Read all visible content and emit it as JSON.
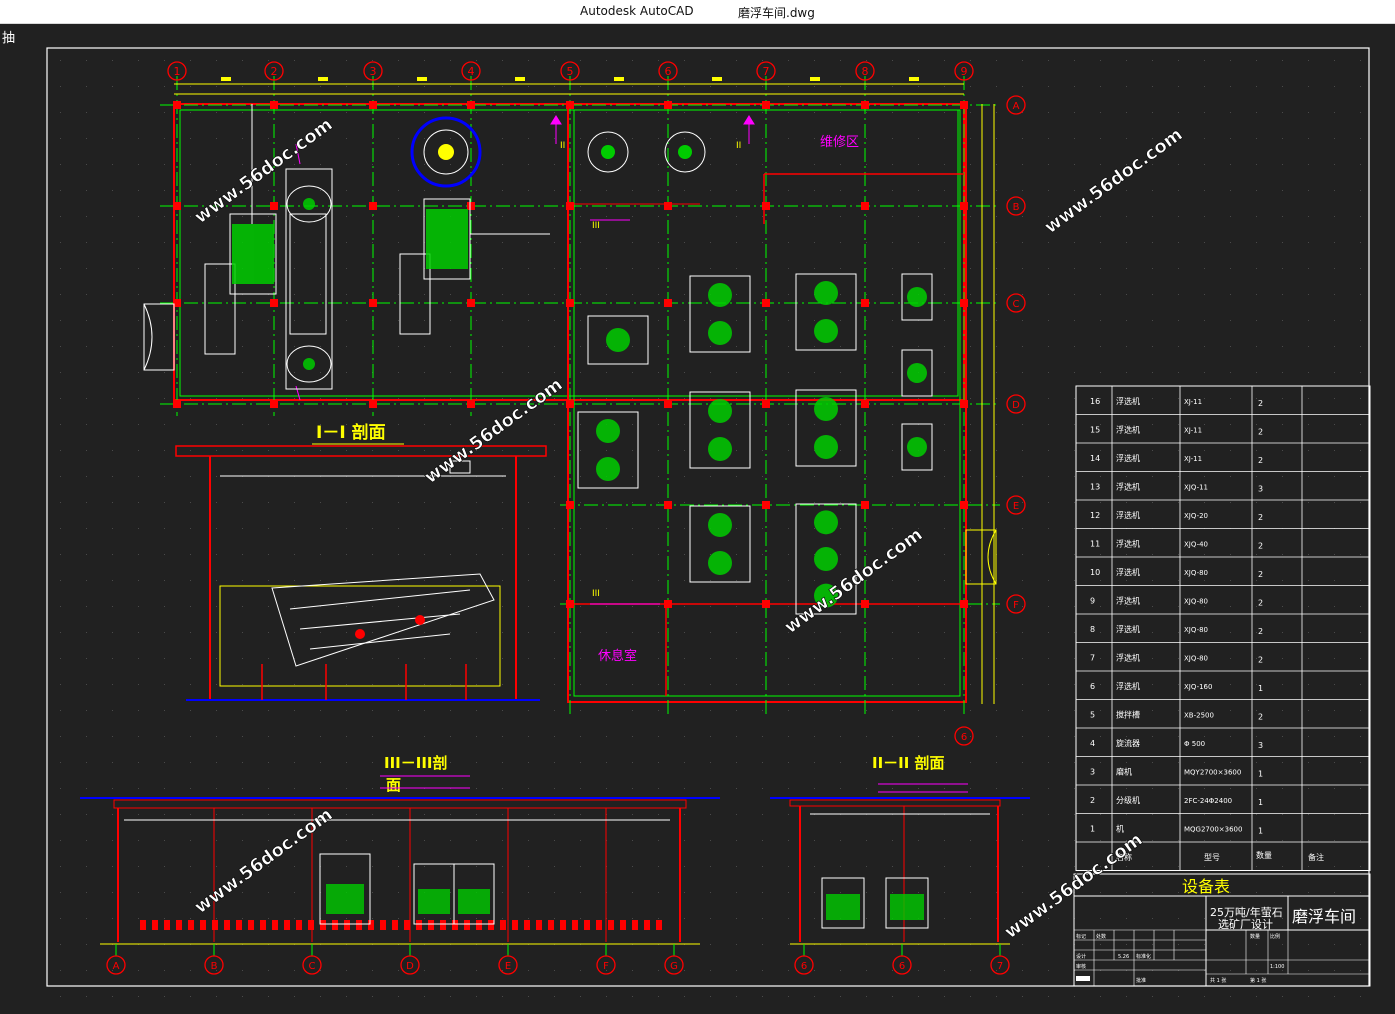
{
  "window": {
    "app_name": "Autodesk AutoCAD",
    "file_name": "磨浮车间.dwg",
    "corner_glyph": "抽"
  },
  "colors": {
    "background": "#212121",
    "frame": "#ffffff",
    "grid_axis": "#00ff00",
    "wall": "#ff0000",
    "dimension": "#ffff00",
    "annotation": "#ff00ff",
    "equipment": "#ffffff",
    "equipment_fill": "#00cc00",
    "accent_blue": "#0000ff",
    "watermark": "#ffffff"
  },
  "drawing": {
    "grid_columns": [
      "1",
      "2",
      "3",
      "4",
      "5",
      "6",
      "7",
      "8",
      "9"
    ],
    "grid_rows": [
      "A",
      "B",
      "C",
      "D",
      "E",
      "F"
    ],
    "room_labels": {
      "maintenance": "维修区",
      "rest_room": "休息室"
    },
    "section_titles": {
      "s1": "I－I 剖面",
      "s2": "II－II 剖面",
      "s3_line1": "III－III剖",
      "s3_line2": "面"
    },
    "section3_axes": [
      "A",
      "B",
      "C",
      "D",
      "E",
      "F",
      "G"
    ],
    "section2_axes": [
      "6",
      "6",
      "7"
    ],
    "watermark_text": "www.56doc.com"
  },
  "equipment_table": {
    "rows": [
      {
        "no": "16",
        "name": "浮选机",
        "model": "XJ-11",
        "qty": "2",
        "note": ""
      },
      {
        "no": "15",
        "name": "浮选机",
        "model": "XJ-11",
        "qty": "2",
        "note": ""
      },
      {
        "no": "14",
        "name": "浮选机",
        "model": "XJ-11",
        "qty": "2",
        "note": ""
      },
      {
        "no": "13",
        "name": "浮选机",
        "model": "XJQ-11",
        "qty": "3",
        "note": ""
      },
      {
        "no": "12",
        "name": "浮选机",
        "model": "XJQ-20",
        "qty": "2",
        "note": ""
      },
      {
        "no": "11",
        "name": "浮选机",
        "model": "XJQ-40",
        "qty": "2",
        "note": ""
      },
      {
        "no": "10",
        "name": "浮选机",
        "model": "XJQ-80",
        "qty": "2",
        "note": ""
      },
      {
        "no": "9",
        "name": "浮选机",
        "model": "XJQ-80",
        "qty": "2",
        "note": ""
      },
      {
        "no": "8",
        "name": "浮选机",
        "model": "XJQ-80",
        "qty": "2",
        "note": ""
      },
      {
        "no": "7",
        "name": "浮选机",
        "model": "XJQ-80",
        "qty": "2",
        "note": ""
      },
      {
        "no": "6",
        "name": "浮选机",
        "model": "XJQ-160",
        "qty": "1",
        "note": ""
      },
      {
        "no": "5",
        "name": "搅拌槽",
        "model": "XB-2500",
        "qty": "2",
        "note": ""
      },
      {
        "no": "4",
        "name": "旋流器",
        "model": "Φ 500",
        "qty": "3",
        "note": ""
      },
      {
        "no": "3",
        "name": "磨机",
        "model": "MQY2700×3600",
        "qty": "1",
        "note": ""
      },
      {
        "no": "2",
        "name": "分级机",
        "model": "2FC-24Φ2400",
        "qty": "1",
        "note": ""
      },
      {
        "no": "1",
        "name": "机",
        "model": "MQG2700×3600",
        "qty": "1",
        "note": ""
      }
    ],
    "header": {
      "name": "名称",
      "model": "型号",
      "qty": "数量",
      "note": "备注"
    },
    "title": "设备表"
  },
  "title_block": {
    "project_line1": "25万吨/年萤石",
    "project_line2": "选矿厂设计",
    "drawing_name": "磨浮车间",
    "label_biaoji": "标记",
    "label_chushu": "处数",
    "label_sheji": "设计",
    "label_date": "5.26",
    "label_biaozhun": "标准化",
    "label_shenhe": "审核",
    "label_pizhun": "批准",
    "label_shuliang": "数量",
    "label_bili": "比例",
    "scale_value": "1:100",
    "sheet_text": "共 1 张",
    "sheet_no_text": "第 1 张"
  }
}
